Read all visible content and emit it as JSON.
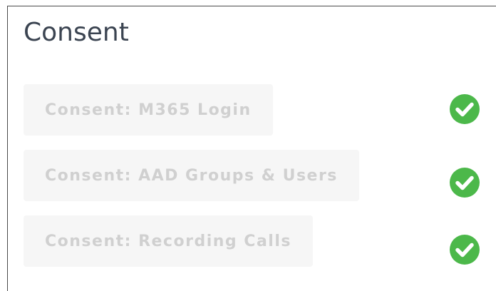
{
  "section": {
    "title": "Consent"
  },
  "consent_items": [
    {
      "label": "Consent: M365 Login",
      "status": "granted",
      "icon": "check-circle-icon"
    },
    {
      "label": "Consent: AAD Groups & Users",
      "status": "granted",
      "icon": "check-circle-icon"
    },
    {
      "label": "Consent: Recording Calls",
      "status": "granted",
      "icon": "check-circle-icon"
    }
  ],
  "colors": {
    "title": "#3b4451",
    "button_bg": "#f6f6f6",
    "button_text_disabled": "#d0d0d0",
    "success": "#4cb84a",
    "border": "#4a4a4a"
  }
}
